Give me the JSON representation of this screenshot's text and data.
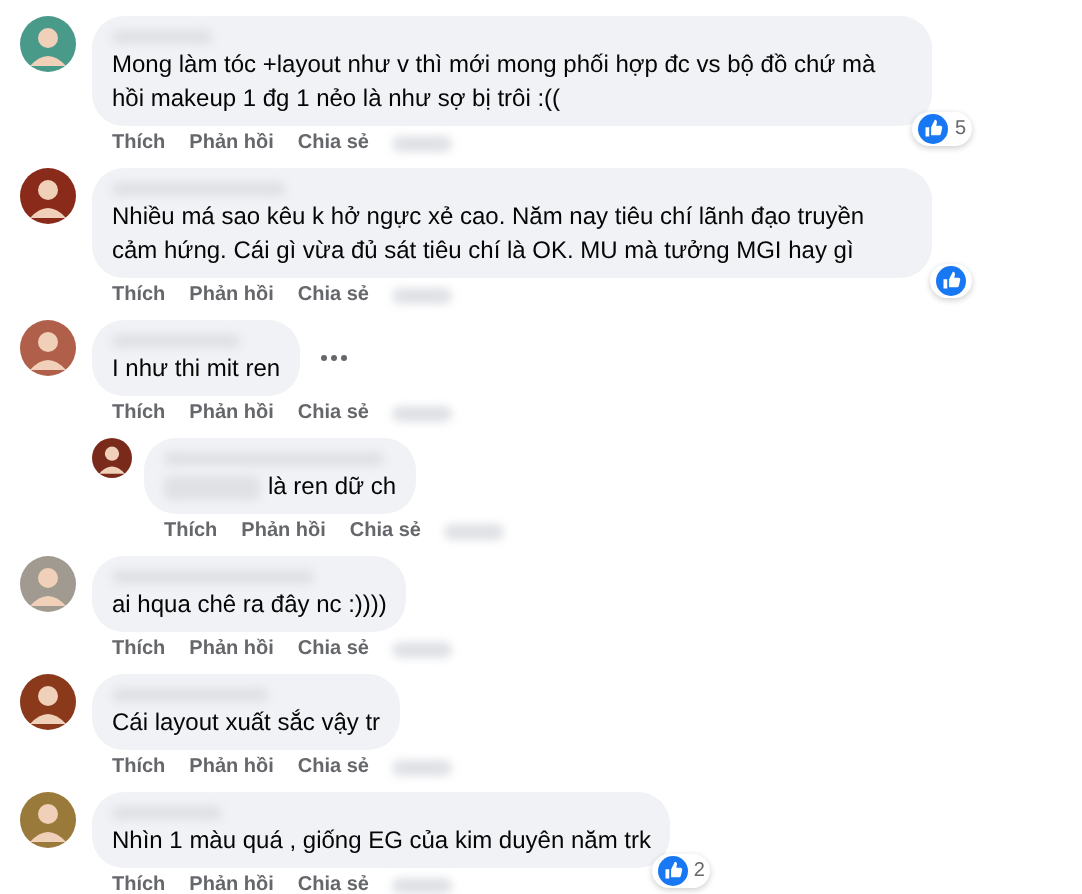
{
  "comments": [
    {
      "text": "Mong làm tóc +layout như v thì mới mong phối hợp đc vs bộ đồ chứ mà hồi makeup 1 đg 1 nẻo là như sợ bị trôi :((",
      "reaction": true,
      "reaction_count": "5",
      "actions": [
        "Thích",
        "Phản hồi",
        "Chia sẻ"
      ]
    },
    {
      "text": "Nhiều má sao kêu k hở ngực xẻ cao. Năm nay tiêu chí lãnh đạo truyền cảm hứng. Cái gì vừa đủ sát tiêu chí là OK. MU mà tưởng MGI hay gì",
      "reaction": true,
      "actions": [
        "Thích",
        "Phản hồi",
        "Chia sẻ"
      ]
    },
    {
      "text": "I như thi mit ren",
      "more_menu": true,
      "actions": [
        "Thích",
        "Phản hồi",
        "Chia sẻ"
      ],
      "replies": [
        {
          "text": "là ren dữ ch",
          "actions": [
            "Thích",
            "Phản hồi",
            "Chia sẻ"
          ]
        }
      ]
    },
    {
      "text": "ai hqua chê ra đây nc :))))",
      "actions": [
        "Thích",
        "Phản hồi",
        "Chia sẻ"
      ]
    },
    {
      "text": "Cái layout xuất sắc vậy tr",
      "actions": [
        "Thích",
        "Phản hồi",
        "Chia sẻ"
      ]
    },
    {
      "text": "Nhìn 1 màu quá , giống EG của kim duyên năm trk",
      "reaction": true,
      "reaction_count": "2",
      "actions": [
        "Thích",
        "Phản hồi",
        "Chia sẻ"
      ]
    }
  ]
}
